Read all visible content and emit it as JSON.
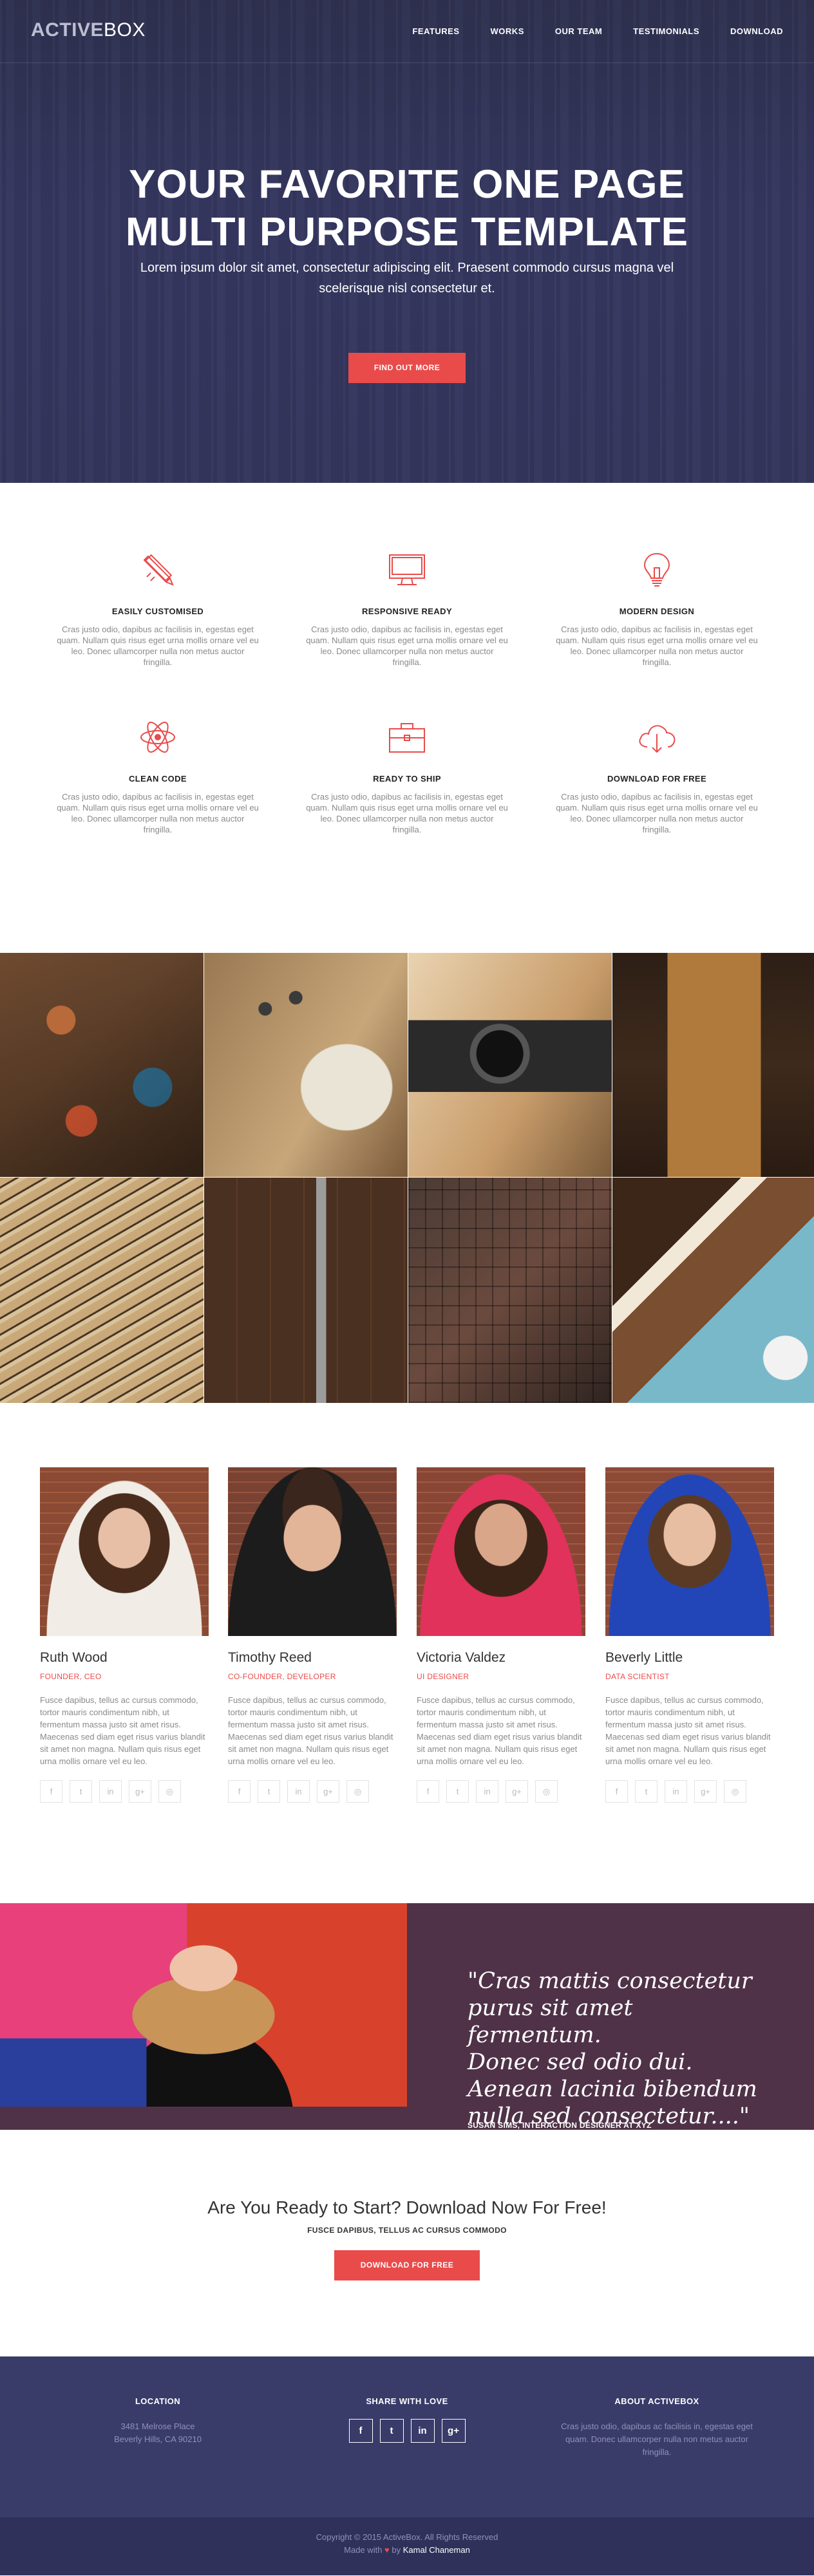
{
  "brand": {
    "logo_bold": "ACTIVE",
    "logo_light": "BOX",
    "accent_color": "#e94b4b",
    "dark_color": "#393c69"
  },
  "nav": {
    "items": [
      "FEATURES",
      "WORKS",
      "OUR TEAM",
      "TESTIMONIALS",
      "DOWNLOAD"
    ]
  },
  "hero": {
    "title_line1": "YOUR FAVORITE ONE PAGE",
    "title_line2": "MULTI PURPOSE TEMPLATE",
    "subtitle_line1": "Lorem ipsum dolor sit amet, consectetur adipiscing elit. Praesent commodo cursus magna vel",
    "subtitle_line2": "scelerisque nisl consectetur et.",
    "cta_label": "FIND OUT MORE"
  },
  "features": [
    {
      "icon": "pencil-ruler-icon",
      "title": "EASILY CUSTOMISED",
      "text": "Cras justo odio, dapibus ac facilisis in, egestas eget quam. Nullam quis risus eget urna mollis ornare vel eu leo. Donec ullamcorper nulla non metus auctor fringilla."
    },
    {
      "icon": "monitor-icon",
      "title": "RESPONSIVE READY",
      "text": "Cras justo odio, dapibus ac facilisis in, egestas eget quam. Nullam quis risus eget urna mollis ornare vel eu leo. Donec ullamcorper nulla non metus auctor fringilla."
    },
    {
      "icon": "lightbulb-icon",
      "title": "MODERN DESIGN",
      "text": "Cras justo odio, dapibus ac facilisis in, egestas eget quam. Nullam quis risus eget urna mollis ornare vel eu leo. Donec ullamcorper nulla non metus auctor fringilla."
    },
    {
      "icon": "atom-icon",
      "title": "CLEAN CODE",
      "text": "Cras justo odio, dapibus ac facilisis in, egestas eget quam. Nullam quis risus eget urna mollis ornare vel eu leo. Donec ullamcorper nulla non metus auctor fringilla."
    },
    {
      "icon": "briefcase-icon",
      "title": "READY TO SHIP",
      "text": "Cras justo odio, dapibus ac facilisis in, egestas eget quam. Nullam quis risus eget urna mollis ornare vel eu leo. Donec ullamcorper nulla non metus auctor fringilla."
    },
    {
      "icon": "cloud-download-icon",
      "title": "DOWNLOAD FOR FREE",
      "text": "Cras justo odio, dapibus ac facilisis in, egestas eget quam. Nullam quis risus eget urna mollis ornare vel eu leo. Donec ullamcorper nulla non metus auctor fringilla."
    }
  ],
  "portfolio": {
    "tiles": 8
  },
  "team": [
    {
      "name": "Ruth Wood",
      "role": "FOUNDER, CEO",
      "bio": "Fusce dapibus, tellus ac cursus commodo, tortor mauris condimentum nibh, ut fermentum massa justo sit amet risus. Maecenas sed diam eget risus varius blandit sit amet non magna. Nullam quis risus eget urna mollis ornare vel eu leo."
    },
    {
      "name": "Timothy Reed",
      "role": "CO-FOUNDER, DEVELOPER",
      "bio": "Fusce dapibus, tellus ac cursus commodo, tortor mauris condimentum nibh, ut fermentum massa justo sit amet risus. Maecenas sed diam eget risus varius blandit sit amet non magna. Nullam quis risus eget urna mollis ornare vel eu leo."
    },
    {
      "name": "Victoria Valdez",
      "role": "UI DESIGNER",
      "bio": "Fusce dapibus, tellus ac cursus commodo, tortor mauris condimentum nibh, ut fermentum massa justo sit amet risus. Maecenas sed diam eget risus varius blandit sit amet non magna. Nullam quis risus eget urna mollis ornare vel eu leo."
    },
    {
      "name": "Beverly Little",
      "role": "DATA SCIENTIST",
      "bio": "Fusce dapibus, tellus ac cursus commodo, tortor mauris condimentum nibh, ut fermentum massa justo sit amet risus. Maecenas sed diam eget risus varius blandit sit amet non magna. Nullam quis risus eget urna mollis ornare vel eu leo."
    }
  ],
  "member_socials": [
    "f",
    "t",
    "in",
    "g+",
    "◎"
  ],
  "testimonial": {
    "quote_line1": "\"Cras mattis consectetur",
    "quote_line2": "purus sit amet fermentum.",
    "quote_line3": "Donec sed odio dui.",
    "quote_line4": "Aenean lacinia bibendum",
    "quote_line5": "nulla sed consectetur....\"",
    "author": "SUSAN SIMS, INTERACTION DESIGNER AT XYZ"
  },
  "cta": {
    "title": "Are You Ready to Start? Download Now For Free!",
    "subtitle": "FUSCE DAPIBUS, TELLUS AC CURSUS COMMODO",
    "button": "DOWNLOAD FOR FREE"
  },
  "footer": {
    "location_title": "LOCATION",
    "address_line1": "3481 Melrose Place",
    "address_line2": "Beverly Hills, CA 90210",
    "share_title": "SHARE WITH LOVE",
    "share_icons": [
      "f",
      "t",
      "in",
      "g+"
    ],
    "about_title": "ABOUT ACTIVEBOX",
    "about_text": "Cras justo odio, dapibus ac facilisis in, egestas eget quam. Donec ullamcorper nulla non metus auctor fringilla.",
    "copyright": "Copyright © 2015 ActiveBox. All Rights Reserved",
    "made_with": "Made with",
    "heart": "♥",
    "by": "by",
    "author": "Kamal Chaneman"
  }
}
